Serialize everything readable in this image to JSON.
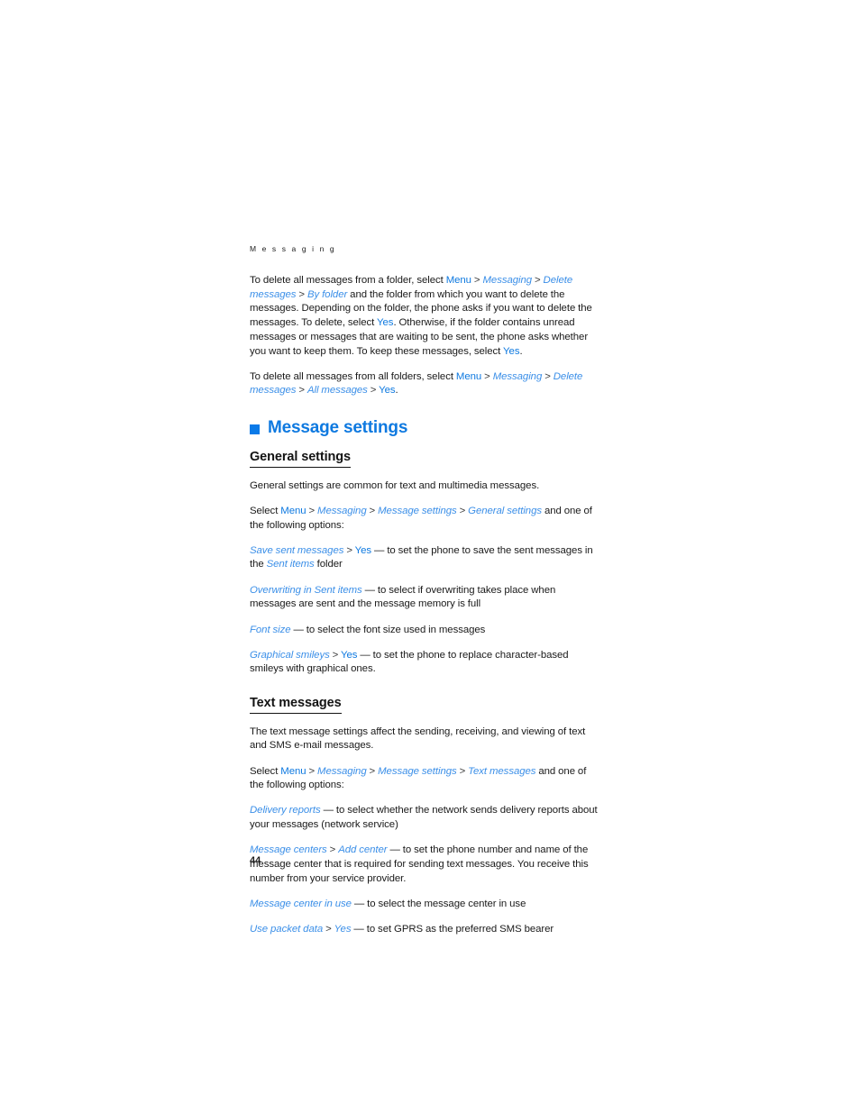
{
  "document": {
    "running_head": "M e s s a g i n g",
    "page_number": "44",
    "accent_color": "#0e79e0",
    "accent_italic_color": "#3b8fe8",
    "bullet_color": "#0a7ae8",
    "body_color": "#1a1a1a"
  },
  "paragraphs": {
    "delete_folder": {
      "t1": "To delete all messages from a folder, select ",
      "menu": "Menu",
      "s1": " > ",
      "messaging": "Messaging",
      "s2": " > ",
      "delete_messages": "Delete messages",
      "s3": " > ",
      "by_folder": "By folder",
      "t2": " and the folder from which you want to delete the messages. Depending on the folder, the phone asks if you want to delete the messages. To delete, select ",
      "yes1": "Yes",
      "t3": ". Otherwise, if the folder contains unread messages or messages that are waiting to be sent, the phone asks whether you want to keep them. To keep these messages, select ",
      "yes2": "Yes",
      "t4": "."
    },
    "delete_all": {
      "t1": "To delete all messages from all folders, select ",
      "menu": "Menu",
      "s1": " > ",
      "messaging": "Messaging",
      "s2": " > ",
      "delete_messages": "Delete messages",
      "s3": " > ",
      "all_messages": "All messages",
      "s4": " > ",
      "yes": "Yes",
      "t2": "."
    }
  },
  "message_settings": {
    "heading": "Message settings",
    "general": {
      "heading": "General settings",
      "intro": "General settings are common for text and multimedia messages.",
      "select": {
        "t1": "Select ",
        "menu": "Menu",
        "s1": " > ",
        "messaging": "Messaging",
        "s2": " > ",
        "message_settings": "Message settings",
        "s3": " > ",
        "general_settings": "General settings",
        "t2": " and one of the following options:"
      },
      "options": {
        "save_sent": {
          "label": "Save sent messages",
          "sep": " > ",
          "value": "Yes",
          "dash": " — ",
          "desc_before": "to set the phone to save the sent messages in the ",
          "folder": "Sent items",
          "desc_after": " folder"
        },
        "overwriting": {
          "label": "Overwriting in Sent items",
          "dash": " — ",
          "desc": "to select if overwriting takes place when messages are sent and the message memory is full"
        },
        "font_size": {
          "label": "Font size",
          "dash": " — ",
          "desc": "to select the font size used in messages"
        },
        "smileys": {
          "label": "Graphical smileys",
          "sep": " > ",
          "value": "Yes",
          "dash": " — ",
          "desc": "to set the phone to replace character-based smileys with graphical ones."
        }
      }
    },
    "text_messages": {
      "heading": "Text messages",
      "intro": "The text message settings affect the sending, receiving, and viewing of text and SMS e-mail messages.",
      "select": {
        "t1": "Select ",
        "menu": "Menu",
        "s1": " > ",
        "messaging": "Messaging",
        "s2": " > ",
        "message_settings": "Message settings",
        "s3": " > ",
        "text_messages": "Text messages",
        "t2": " and one of the following options:"
      },
      "options": {
        "delivery_reports": {
          "label": "Delivery reports",
          "dash": " — ",
          "desc": "to select whether the network sends delivery reports about your messages (network service)"
        },
        "message_centers": {
          "label": "Message centers",
          "sep": " > ",
          "value": "Add center",
          "dash": " — ",
          "desc": "to set the phone number and name of the message center that is required for sending text messages. You receive this number from your service provider."
        },
        "center_in_use": {
          "label": "Message center in use",
          "dash": " — ",
          "desc": "to select the message center in use"
        },
        "packet_data": {
          "label": "Use packet data",
          "sep": " > ",
          "value": "Yes",
          "dash": " — ",
          "desc": "to set GPRS as the preferred SMS bearer"
        }
      }
    }
  }
}
